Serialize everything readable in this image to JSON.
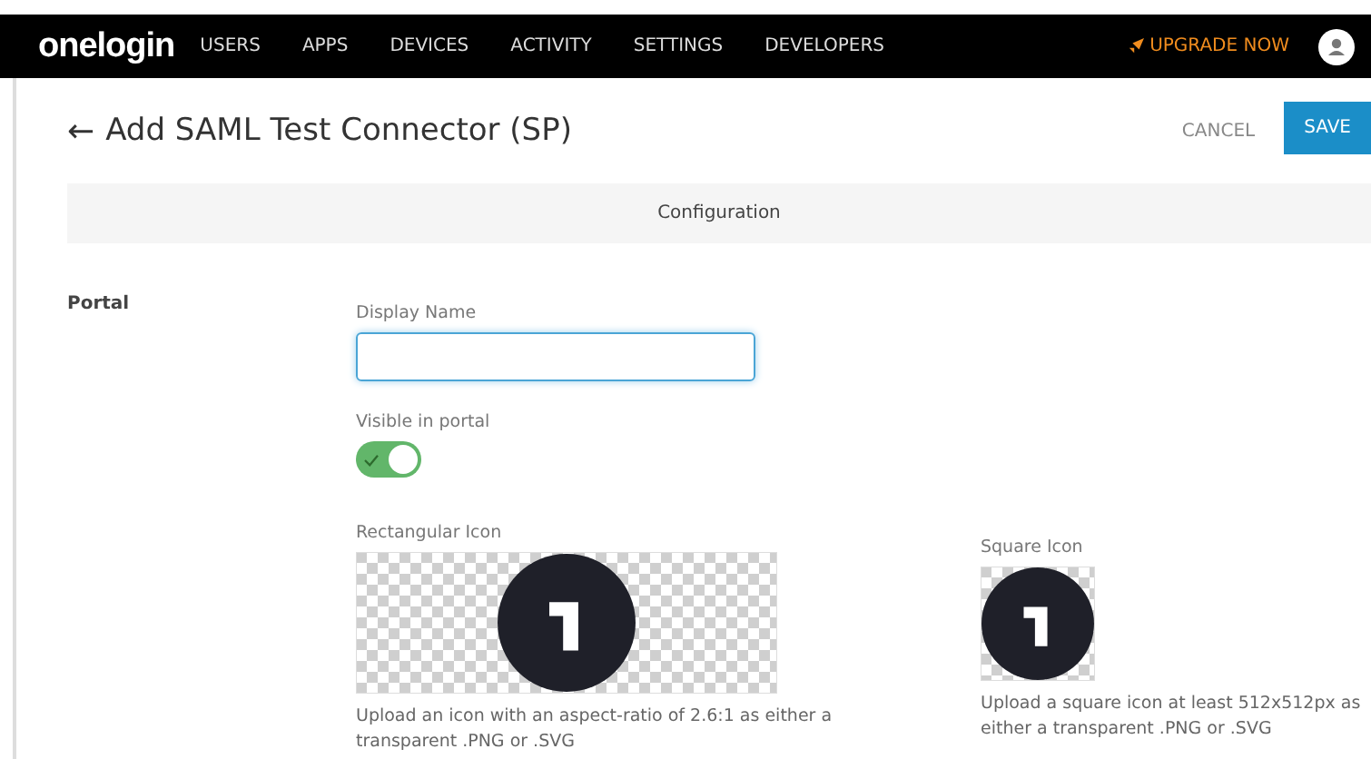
{
  "nav": {
    "logo": "onelogin",
    "items": [
      {
        "label": "USERS"
      },
      {
        "label": "APPS"
      },
      {
        "label": "DEVICES"
      },
      {
        "label": "ACTIVITY"
      },
      {
        "label": "SETTINGS"
      },
      {
        "label": "DEVELOPERS"
      }
    ],
    "upgrade": "UPGRADE NOW"
  },
  "header": {
    "back": "←",
    "title": "Add SAML Test Connector (SP)",
    "cancel": "CANCEL",
    "save": "SAVE"
  },
  "tabs": [
    {
      "label": "Configuration",
      "selected": true
    }
  ],
  "section": {
    "title": "Portal",
    "display_name": {
      "label": "Display Name",
      "focused": true
    },
    "visible": {
      "label": "Visible in portal",
      "on": true
    },
    "icons": [
      {
        "kind": "rect",
        "label": "Rectangular Icon",
        "hint": "Upload an icon with an aspect-ratio of 2.6:1 as either a transparent .PNG or .SVG"
      },
      {
        "kind": "square",
        "label": "Square Icon",
        "hint": "Upload a square icon at least 512x512px as either a transparent .PNG or .SVG"
      }
    ]
  }
}
